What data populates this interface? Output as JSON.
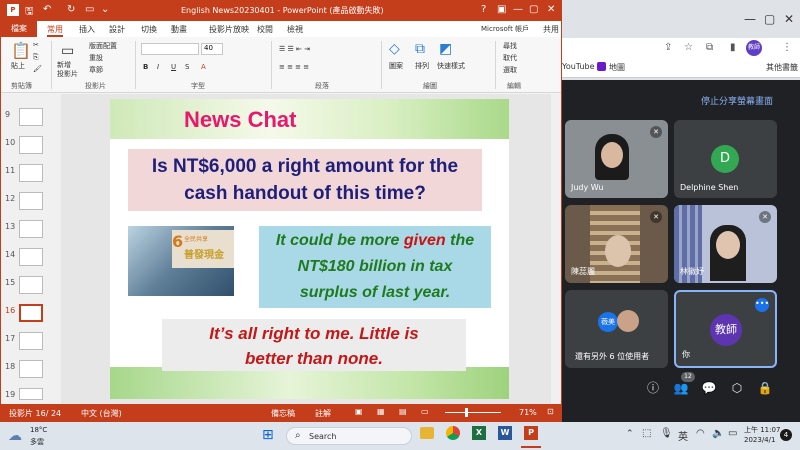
{
  "ppt": {
    "title": "English News20230401  -  PowerPoint (產品啟動失敗)",
    "help": "?",
    "file_tab": "檔案",
    "tabs": [
      "常用",
      "插入",
      "設計",
      "切換",
      "動畫",
      "投影片放映",
      "校閱",
      "檢視"
    ],
    "account": "Microsoft 帳戶",
    "share": "共用",
    "ribbon": {
      "paste": "貼上",
      "new_slide": "新增\n投影片",
      "layout": "版面配置",
      "reset": "重設",
      "section": "章節",
      "shapes": "圖案",
      "arrange": "排列",
      "quick_styles": "快速樣式",
      "find": "尋找",
      "replace": "取代",
      "select": "選取",
      "groups": [
        "剪貼簿",
        "投影片",
        "字型",
        "段落",
        "繪圖",
        "編輯"
      ],
      "font_size": "40"
    },
    "slide_numbers": [
      "9",
      "10",
      "11",
      "12",
      "13",
      "14",
      "15",
      "16",
      "17",
      "18",
      "19"
    ],
    "status": {
      "slide_pos": "投影片 16/ 24",
      "lang": "中文 (台灣)",
      "notes": "備忘稿",
      "comments": "註解",
      "zoom": "71%"
    },
    "slide": {
      "title": "News Chat",
      "question": "Is NT$6,000 a right amount for the cash handout of this time?",
      "green_pre": "It could be more ",
      "green_red": "given",
      "green_post": " the NT$180 billion in tax surplus of last year.",
      "answer_line1": "It’s all right to me. Little is",
      "answer_line2": "better than none.",
      "image_text_1": "全民共享",
      "image_text_2": "普發現金"
    }
  },
  "chrome": {
    "bookmarks": [
      "YouTube",
      "地圖",
      "其他書籤"
    ],
    "profile": "教師"
  },
  "meet": {
    "stop_share": "停止分享螢幕畫面",
    "participants": [
      {
        "name": "Judy Wu"
      },
      {
        "name": "Delphine Shen",
        "initial": "D"
      },
      {
        "name": "陳蕊麗"
      },
      {
        "name": "林徽妤"
      }
    ],
    "others": "還有另外 6 位使用者",
    "others_avatar": "薇美",
    "self_avatar": "教師",
    "self_name": "你",
    "people_count": "12"
  },
  "taskbar": {
    "weather_temp": "18°C",
    "weather_desc": "多雲",
    "search": "Search",
    "ime": "英",
    "time": "上午 11:07",
    "date": "2023/4/1",
    "notif": "4"
  },
  "colors": {
    "ppt_accent": "#c43e1c",
    "meet_bg": "#202124",
    "slide_title": "#e6196e",
    "question_text": "#1f1f7a",
    "green_text": "#1f7a1f",
    "red_text": "#cc1111"
  }
}
